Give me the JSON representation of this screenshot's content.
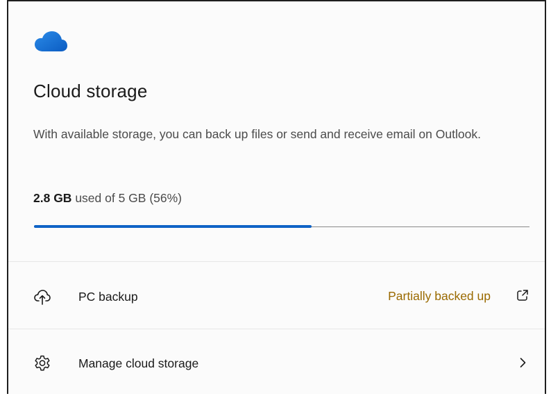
{
  "card": {
    "title": "Cloud storage",
    "description": "With available storage, you can back up files or send and receive email on Outlook.",
    "usage": {
      "used_text": "2.8 GB",
      "rest_text": " used of 5 GB (56%)",
      "fraction": 0.56
    }
  },
  "rows": {
    "pc_backup": {
      "icon": "cloud-upload-icon",
      "label": "PC backup",
      "status": "Partially backed up",
      "trail_icon": "external-link-icon"
    },
    "manage": {
      "icon": "gear-icon",
      "label": "Manage cloud storage",
      "trail_icon": "chevron-right-icon"
    }
  },
  "colors": {
    "accent": "#0f63c6",
    "warning_text": "#9a6a00",
    "cloud": "#1a74d2"
  }
}
